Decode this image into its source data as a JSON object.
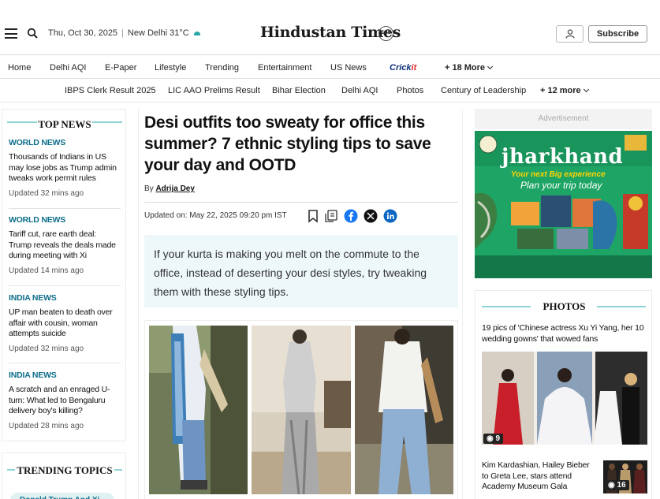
{
  "header": {
    "date": "Thu, Oct 30, 2025",
    "weather": "New Delhi 31°C",
    "logo": "Hindustan Times",
    "logo_badge": "100",
    "subscribe_label": "Subscribe"
  },
  "nav_primary": {
    "items": [
      "Home",
      "Delhi AQI",
      "E-Paper",
      "Lifestyle",
      "Trending",
      "Entertainment",
      "US News"
    ],
    "cricket_prefix": "Crick",
    "cricket_suffix": "it",
    "more_label": "+ 18 More"
  },
  "nav_secondary": {
    "items": [
      "IBPS Clerk Result 2025",
      "LIC AAO Prelims Result",
      "Bihar Election",
      "Delhi AQI",
      "Photos",
      "Century of Leadership"
    ],
    "more_label": "+ 12 more"
  },
  "top_news": {
    "heading": "TOP NEWS",
    "items": [
      {
        "category": "WORLD NEWS",
        "title": "Thousands of Indians in US may lose jobs as Trump admin tweaks work permit rules",
        "time": "Updated 32 mins ago"
      },
      {
        "category": "WORLD NEWS",
        "title": "Tariff cut, rare earth deal: Trump reveals the deals made during meeting with Xi",
        "time": "Updated 14 mins ago"
      },
      {
        "category": "INDIA NEWS",
        "title": "UP man beaten to death over affair with cousin, woman attempts suicide",
        "time": "Updated 32 mins ago"
      },
      {
        "category": "INDIA NEWS",
        "title": "A scratch and an enraged U-turn: What led to Bengaluru delivery boy's killing?",
        "time": "Updated 28 mins ago"
      }
    ]
  },
  "trending": {
    "heading": "TRENDING TOPICS",
    "first_pill": "Donald Trump And Xi"
  },
  "article": {
    "headline": "Desi outfits too sweaty for office this summer? 7 ethnic styling tips to save your day and OOTD",
    "by_prefix": "By",
    "author": "Adrija Dey",
    "updated": "Updated on: May 22, 2025 09:20 pm IST",
    "summary": "If your kurta is making you melt on the commute to the office, instead of deserting your desi styles, try tweaking them with these styling tips."
  },
  "ad": {
    "label": "Advertisement",
    "brand": "jharkhand",
    "tagline": "Your next Big experience",
    "cta": "Plan your trip today",
    "colors": {
      "bg": "#1ea566",
      "brand_text": "#ffffff",
      "tagline": "#ffd400"
    }
  },
  "photos": {
    "heading": "PHOTOS",
    "galleries": [
      {
        "title": "19 pics of 'Chinese actress Xu Yi Yang, her 10 wedding gowns' that wowed fans",
        "count": "9"
      },
      {
        "title": "Kim Kardashian, Hailey Bieber to Greta Lee, stars attend Academy Museum Gala",
        "count": "16"
      }
    ]
  },
  "colors": {
    "accent_teal": "#0d6e8a",
    "summary_bg": "#eef8fb"
  }
}
